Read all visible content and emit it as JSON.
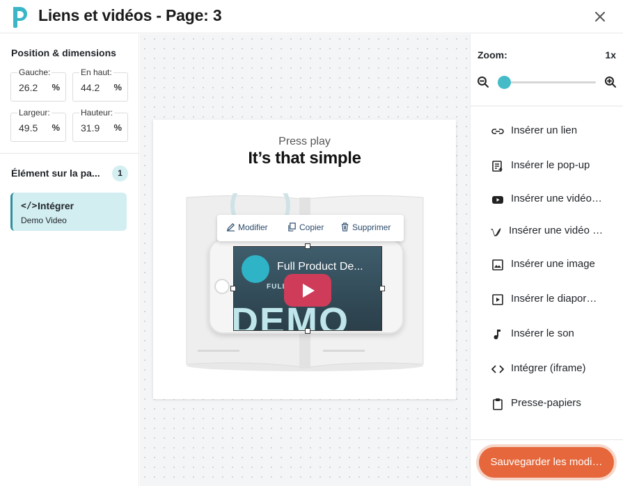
{
  "header": {
    "title": "Liens et vidéos - Page: 3"
  },
  "left": {
    "section_title": "Position & dimensions",
    "fields": {
      "left": {
        "label": "Gauche:",
        "value": "26.2",
        "unit": "%"
      },
      "top": {
        "label": "En haut:",
        "value": "44.2",
        "unit": "%"
      },
      "width": {
        "label": "Largeur:",
        "value": "49.5",
        "unit": "%"
      },
      "height": {
        "label": "Hauteur:",
        "value": "31.9",
        "unit": "%"
      }
    },
    "elements_title": "Élément sur la pa...",
    "elements_count": "1",
    "element": {
      "icon": "</>",
      "name": "Intégrer",
      "sub": "Demo Video"
    }
  },
  "canvas": {
    "small_heading": "Press play",
    "big_heading": "It’s that simple",
    "toolbar": {
      "edit": "Modifier",
      "copy": "Copier",
      "delete": "Supprimer"
    },
    "video": {
      "title": "Full Product De...",
      "sub": "FULL DEMO",
      "word": "DEMO"
    }
  },
  "right": {
    "zoom_label": "Zoom:",
    "zoom_value": "1x",
    "zoom_level": 0.0,
    "tools": [
      {
        "icon": "link-icon",
        "label": "Insérer un lien"
      },
      {
        "icon": "popup-icon",
        "label": "Insérer le pop-up"
      },
      {
        "icon": "youtube-icon",
        "label": "Insérer une vidéo…"
      },
      {
        "icon": "vimeo-icon",
        "label": "Insérer une vidéo …"
      },
      {
        "icon": "image-icon",
        "label": "Insérer une image"
      },
      {
        "icon": "slideshow-icon",
        "label": "Insérer le diapor…"
      },
      {
        "icon": "music-icon",
        "label": "Insérer le son"
      },
      {
        "icon": "code-icon",
        "label": "Intégrer (iframe)"
      },
      {
        "icon": "clipboard-icon",
        "label": "Presse-papiers"
      }
    ],
    "save_label": "Sauvegarder les modi…"
  },
  "colors": {
    "accent": "#44bcc8",
    "save": "#e5673b",
    "selection": "#d2eef0"
  }
}
